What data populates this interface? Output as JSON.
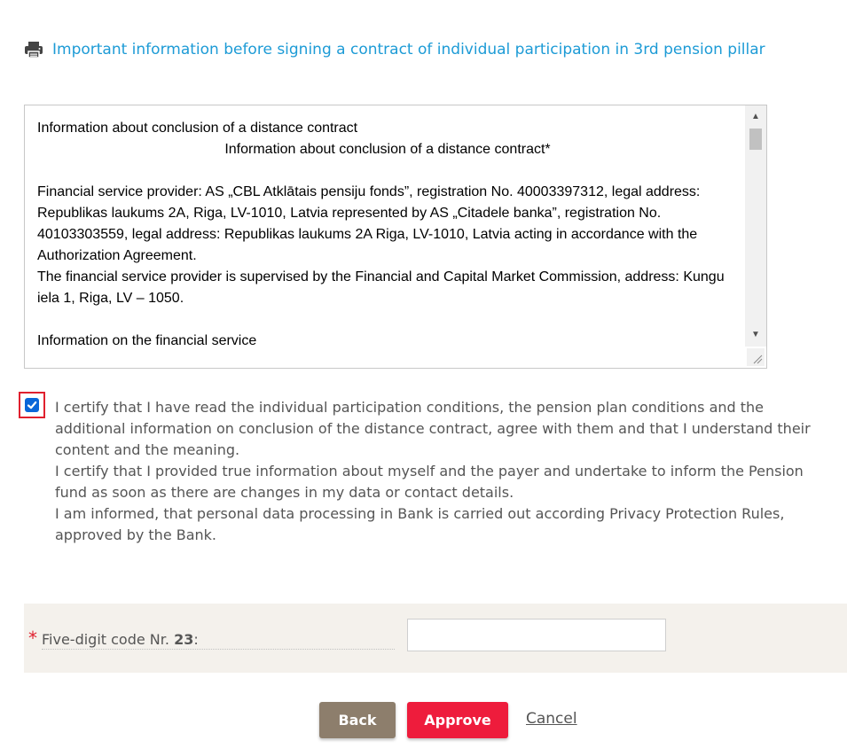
{
  "print_link": {
    "text": "Important information before signing a contract of individual participation in 3rd pension pillar",
    "icon": "printer-icon",
    "color": "#1d9bd6"
  },
  "contract": {
    "lines": [
      "Information about conclusion of a distance contract",
      "Information about conclusion of a distance contract*",
      "Financial service provider: AS „CBL Atklātais pensiju fonds”, registration No.  40003397312, legal address: Republikas laukums 2A, Riga, LV-1010, Latvia represented by AS „Citadele banka”, registration No. 40103303559, legal address: Republikas laukums 2A Riga, LV-1010, Latvia acting in accordance with the Authorization Agreement.",
      "The financial service provider is supervised by the Financial and Capital Market Commission, address: Kungu iela 1, Riga, LV – 1050.",
      "Information on the financial service"
    ]
  },
  "consent": {
    "checked": true,
    "paragraphs": [
      "I certify that I have read the individual participation conditions, the pension plan conditions and the additional information on conclusion of the distance contract, agree with them and that I understand their content and the meaning.",
      "I certify that I provided true information about myself and the payer and undertake to inform the Pension fund as soon as there are changes in my data or contact details.",
      "I am informed, that personal data processing in Bank is carried out according Privacy Protection Rules, approved by the Bank."
    ]
  },
  "code": {
    "required_mark": "*",
    "label": "Five-digit code Nr.",
    "number": "23",
    "suffix": ":",
    "value": ""
  },
  "buttons": {
    "back": "Back",
    "approve": "Approve",
    "cancel": "Cancel"
  },
  "colors": {
    "accent_red": "#ee1c3c",
    "back_brown": "#8d7e6c",
    "checkbox_blue": "#0a66d8"
  }
}
